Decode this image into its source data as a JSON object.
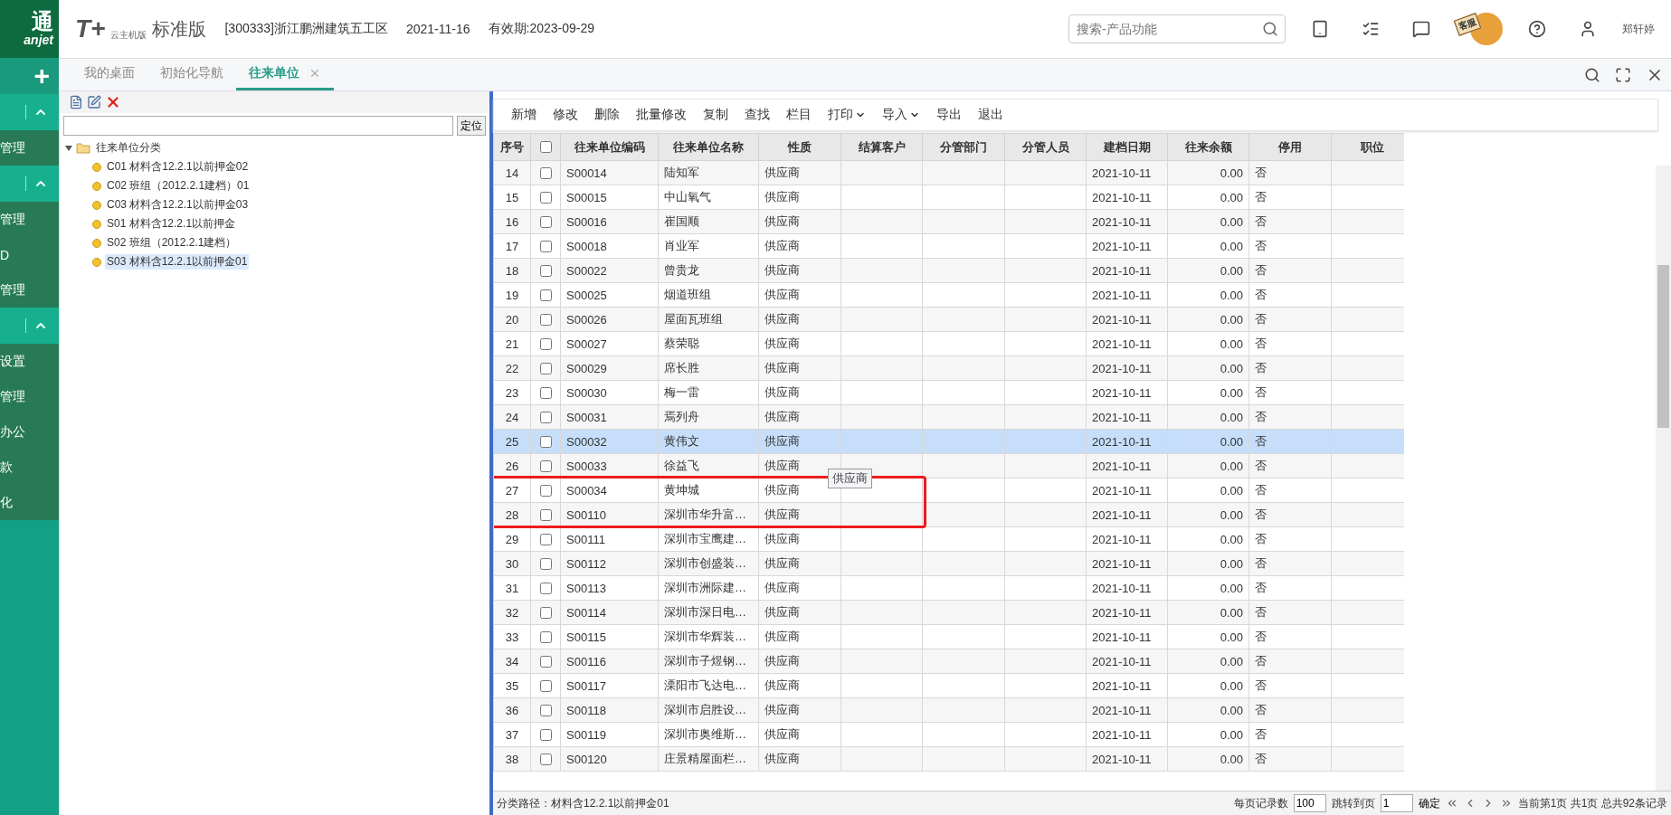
{
  "header": {
    "logo_main": "通",
    "logo_sub": "anjet",
    "product_mark": "T+",
    "product_sub": "云主机版",
    "product": "标准版",
    "company": "[300333]浙江鹏洲建筑五工区",
    "date": "2021-11-16",
    "validity": "有效期:2023-09-29",
    "search": {
      "placeholder": "搜索-产品功能"
    },
    "service_badge": "客服",
    "user": "郑轩婷"
  },
  "tabs": [
    {
      "label": "我的桌面",
      "selected": false,
      "closable": false
    },
    {
      "label": "初始化导航",
      "selected": false,
      "closable": false
    },
    {
      "label": "往来单位",
      "selected": true,
      "closable": true
    }
  ],
  "sidebar": [
    {
      "kind": "add",
      "label": "+"
    },
    {
      "kind": "section",
      "expanded": true
    },
    {
      "kind": "item",
      "label": "管理"
    },
    {
      "kind": "section",
      "expanded": true
    },
    {
      "kind": "item",
      "label": "管理"
    },
    {
      "kind": "item",
      "label": "D"
    },
    {
      "kind": "item",
      "label": "管理"
    },
    {
      "kind": "section",
      "expanded": true
    },
    {
      "kind": "item",
      "label": "设置"
    },
    {
      "kind": "item",
      "label": "管理"
    },
    {
      "kind": "item",
      "label": "办公"
    },
    {
      "kind": "item",
      "label": "款"
    },
    {
      "kind": "item",
      "label": "化"
    }
  ],
  "tree": {
    "locate_button": "定位",
    "root": {
      "label": "往来单位分类",
      "expanded": true,
      "children": [
        {
          "label": "C01 材料含12.2.1以前押金02",
          "selected": false
        },
        {
          "label": "C02 班组（2012.2.1建档）01",
          "selected": false
        },
        {
          "label": "C03 材料含12.2.1以前押金03",
          "selected": false
        },
        {
          "label": "S01 材料含12.2.1以前押金",
          "selected": false
        },
        {
          "label": "S02 班组（2012.2.1建档）",
          "selected": false
        },
        {
          "label": "S03 材料含12.2.1以前押金01",
          "selected": true
        }
      ]
    }
  },
  "toolbar": [
    {
      "label": "新增",
      "dropdown": false
    },
    {
      "label": "修改",
      "dropdown": false
    },
    {
      "label": "删除",
      "dropdown": false
    },
    {
      "label": "批量修改",
      "dropdown": false
    },
    {
      "label": "复制",
      "dropdown": false
    },
    {
      "label": "查找",
      "dropdown": false
    },
    {
      "label": "栏目",
      "dropdown": false
    },
    {
      "label": "打印",
      "dropdown": true
    },
    {
      "label": "导入",
      "dropdown": true
    },
    {
      "label": "导出",
      "dropdown": false
    },
    {
      "label": "退出",
      "dropdown": false
    }
  ],
  "table": {
    "columns": [
      "序号",
      "往来单位编码",
      "往来单位名称",
      "性质",
      "结算客户",
      "分管部门",
      "分管人员",
      "建档日期",
      "往来余额",
      "停用",
      "职位"
    ],
    "all_checked": false,
    "rows": [
      {
        "no": "14",
        "code": "S00014",
        "name": "陆知军",
        "nature": "供应商",
        "date": "2021-10-11",
        "balance": "0.00",
        "stopped": "否",
        "checked": false,
        "selected": false
      },
      {
        "no": "15",
        "code": "S00015",
        "name": "中山氧气",
        "nature": "供应商",
        "date": "2021-10-11",
        "balance": "0.00",
        "stopped": "否",
        "checked": false,
        "selected": false
      },
      {
        "no": "16",
        "code": "S00016",
        "name": "崔国顺",
        "nature": "供应商",
        "date": "2021-10-11",
        "balance": "0.00",
        "stopped": "否",
        "checked": false,
        "selected": false
      },
      {
        "no": "17",
        "code": "S00018",
        "name": "肖业军",
        "nature": "供应商",
        "date": "2021-10-11",
        "balance": "0.00",
        "stopped": "否",
        "checked": false,
        "selected": false
      },
      {
        "no": "18",
        "code": "S00022",
        "name": "曾贵龙",
        "nature": "供应商",
        "date": "2021-10-11",
        "balance": "0.00",
        "stopped": "否",
        "checked": false,
        "selected": false
      },
      {
        "no": "19",
        "code": "S00025",
        "name": "烟道班组",
        "nature": "供应商",
        "date": "2021-10-11",
        "balance": "0.00",
        "stopped": "否",
        "checked": false,
        "selected": false
      },
      {
        "no": "20",
        "code": "S00026",
        "name": "屋面瓦班组",
        "nature": "供应商",
        "date": "2021-10-11",
        "balance": "0.00",
        "stopped": "否",
        "checked": false,
        "selected": false
      },
      {
        "no": "21",
        "code": "S00027",
        "name": "蔡荣聪",
        "nature": "供应商",
        "date": "2021-10-11",
        "balance": "0.00",
        "stopped": "否",
        "checked": false,
        "selected": false
      },
      {
        "no": "22",
        "code": "S00029",
        "name": "席长胜",
        "nature": "供应商",
        "date": "2021-10-11",
        "balance": "0.00",
        "stopped": "否",
        "checked": false,
        "selected": false
      },
      {
        "no": "23",
        "code": "S00030",
        "name": "梅一雷",
        "nature": "供应商",
        "date": "2021-10-11",
        "balance": "0.00",
        "stopped": "否",
        "checked": false,
        "selected": false
      },
      {
        "no": "24",
        "code": "S00031",
        "name": "焉列舟",
        "nature": "供应商",
        "date": "2021-10-11",
        "balance": "0.00",
        "stopped": "否",
        "checked": false,
        "selected": false
      },
      {
        "no": "25",
        "code": "S00032",
        "name": "黄伟文",
        "nature": "供应商",
        "date": "2021-10-11",
        "balance": "0.00",
        "stopped": "否",
        "checked": false,
        "selected": true
      },
      {
        "no": "26",
        "code": "S00033",
        "name": "徐益飞",
        "nature": "供应商",
        "date": "2021-10-11",
        "balance": "0.00",
        "stopped": "否",
        "checked": false,
        "selected": false
      },
      {
        "no": "27",
        "code": "S00034",
        "name": "黄坤城",
        "nature": "供应商",
        "date": "2021-10-11",
        "balance": "0.00",
        "stopped": "否",
        "checked": false,
        "selected": false
      },
      {
        "no": "28",
        "code": "S00110",
        "name": "深圳市华升富…",
        "nature": "供应商",
        "date": "2021-10-11",
        "balance": "0.00",
        "stopped": "否",
        "checked": false,
        "selected": false
      },
      {
        "no": "29",
        "code": "S00111",
        "name": "深圳市宝鹰建…",
        "nature": "供应商",
        "date": "2021-10-11",
        "balance": "0.00",
        "stopped": "否",
        "checked": false,
        "selected": false
      },
      {
        "no": "30",
        "code": "S00112",
        "name": "深圳市创盛装…",
        "nature": "供应商",
        "date": "2021-10-11",
        "balance": "0.00",
        "stopped": "否",
        "checked": false,
        "selected": false
      },
      {
        "no": "31",
        "code": "S00113",
        "name": "深圳市洲际建…",
        "nature": "供应商",
        "date": "2021-10-11",
        "balance": "0.00",
        "stopped": "否",
        "checked": false,
        "selected": false
      },
      {
        "no": "32",
        "code": "S00114",
        "name": "深圳市深日电…",
        "nature": "供应商",
        "date": "2021-10-11",
        "balance": "0.00",
        "stopped": "否",
        "checked": false,
        "selected": false
      },
      {
        "no": "33",
        "code": "S00115",
        "name": "深圳市华辉装…",
        "nature": "供应商",
        "date": "2021-10-11",
        "balance": "0.00",
        "stopped": "否",
        "checked": false,
        "selected": false
      },
      {
        "no": "34",
        "code": "S00116",
        "name": "深圳市子煜钢…",
        "nature": "供应商",
        "date": "2021-10-11",
        "balance": "0.00",
        "stopped": "否",
        "checked": false,
        "selected": false
      },
      {
        "no": "35",
        "code": "S00117",
        "name": "溧阳市飞达电…",
        "nature": "供应商",
        "date": "2021-10-11",
        "balance": "0.00",
        "stopped": "否",
        "checked": false,
        "selected": false
      },
      {
        "no": "36",
        "code": "S00118",
        "name": "深圳市启胜设…",
        "nature": "供应商",
        "date": "2021-10-11",
        "balance": "0.00",
        "stopped": "否",
        "checked": false,
        "selected": false
      },
      {
        "no": "37",
        "code": "S00119",
        "name": "深圳市奥维斯…",
        "nature": "供应商",
        "date": "2021-10-11",
        "balance": "0.00",
        "stopped": "否",
        "checked": false,
        "selected": false
      },
      {
        "no": "38",
        "code": "S00120",
        "name": "庄景精屋面栏…",
        "nature": "供应商",
        "date": "2021-10-11",
        "balance": "0.00",
        "stopped": "否",
        "checked": false,
        "selected": false
      }
    ],
    "tooltip": "供应商"
  },
  "status_bar": {
    "path": "分类路径：材料含12.2.1以前押金01",
    "page_size_label": "每页记录数",
    "page_size": "100",
    "jump_label": "跳转到页",
    "jump_value": "1",
    "confirm": "确定",
    "page_info": "当前第1页 共1页 总共92条记录"
  }
}
